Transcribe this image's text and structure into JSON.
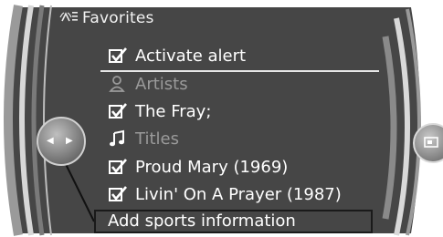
{
  "header": {
    "title": "Favorites",
    "icon": "favorites-broadcast-icon"
  },
  "menu": {
    "items": [
      {
        "label": "Activate alert",
        "icon": "checkbox-icon",
        "state": "enabled"
      },
      {
        "label": "Artists",
        "icon": "person-icon",
        "state": "dim"
      },
      {
        "label": "The Fray;",
        "icon": "checkbox-icon",
        "state": "enabled"
      },
      {
        "label": "Titles",
        "icon": "music-note-icon",
        "state": "dim"
      },
      {
        "label": "Proud Mary (1969)",
        "icon": "checkbox-icon",
        "state": "enabled"
      },
      {
        "label": "Livin' On A Prayer (1987)",
        "icon": "checkbox-icon",
        "state": "enabled"
      }
    ],
    "selected": {
      "label": "Add sports information"
    }
  },
  "controller": {
    "icon": "controller-knob-icon"
  },
  "colors": {
    "background": "#464646",
    "text": "#ffffff",
    "dim_text": "#9a9a9a",
    "highlight_border": "#1a1a1a"
  }
}
